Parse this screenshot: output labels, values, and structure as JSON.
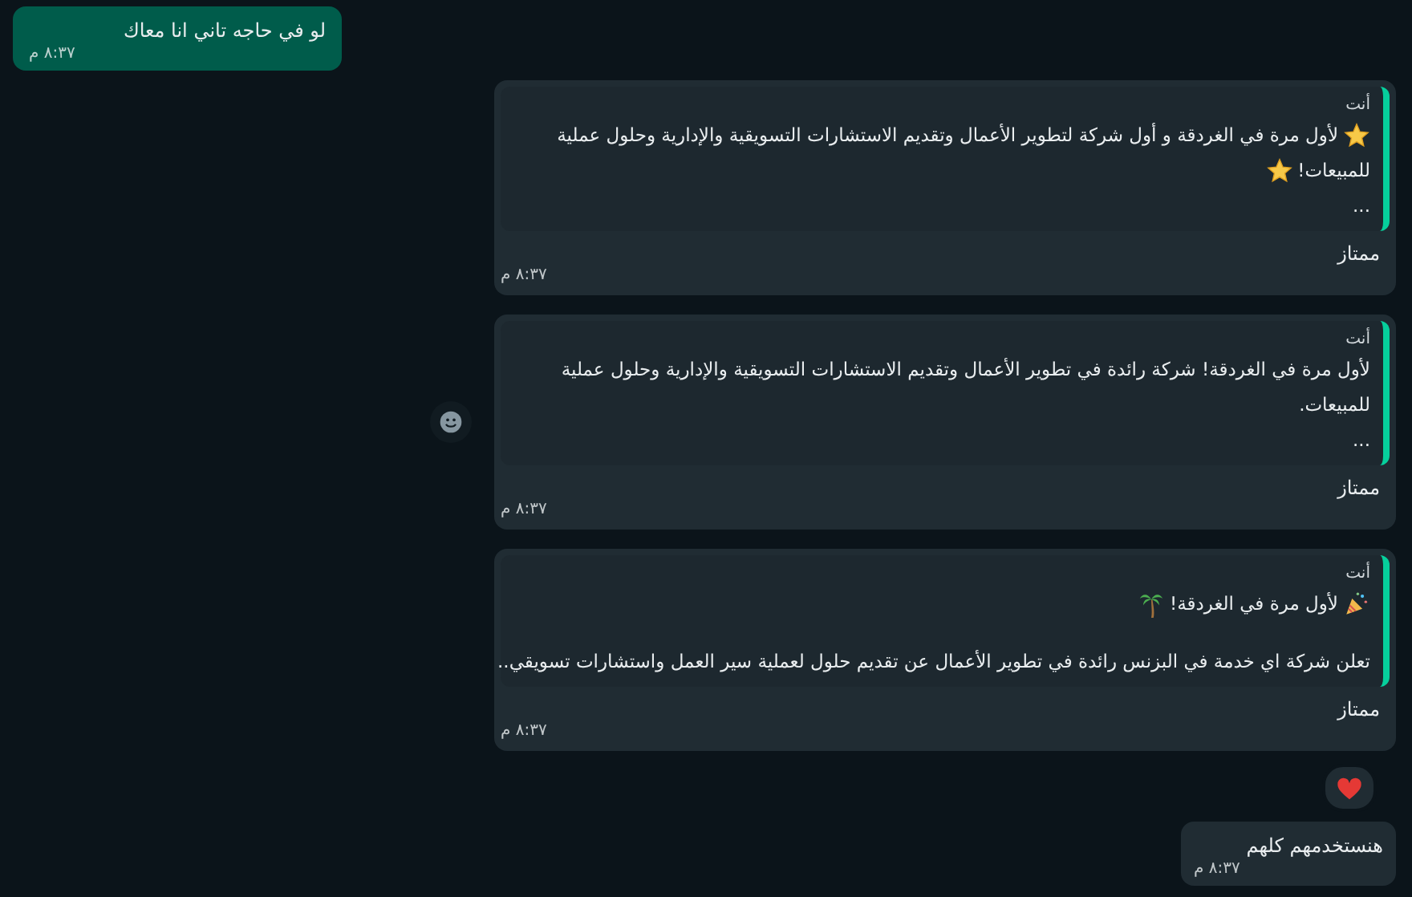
{
  "messages": [
    {
      "kind": "note",
      "text": "لو في حاجه تاني انا معاك",
      "time": "٨:٣٧ م"
    },
    {
      "kind": "reply",
      "quote": {
        "sender": "أنت",
        "paragraphs": [
          [
            {
              "kind": "star"
            },
            {
              "kind": "text",
              "text": "لأول مرة في الغردقة و أول شركة لتطوير الأعمال وتقديم الاستشارات التسويقية والإدارية وحلول عملية"
            }
          ],
          [
            {
              "kind": "text",
              "text": "للمبيعات!"
            },
            {
              "kind": "star"
            }
          ],
          [
            {
              "kind": "text",
              "text": "..."
            }
          ]
        ]
      },
      "text": "ممتاز",
      "time": "٨:٣٧ م",
      "react_button": false,
      "reacted": false
    },
    {
      "kind": "reply",
      "quote": {
        "sender": "أنت",
        "paragraphs": [
          [
            {
              "kind": "text",
              "text": "لأول مرة في الغردقة! شركة رائدة في تطوير الأعمال وتقديم الاستشارات التسويقية والإدارية وحلول عملية"
            }
          ],
          [
            {
              "kind": "text",
              "text": "للمبيعات."
            }
          ],
          [
            {
              "kind": "text",
              "text": "..."
            }
          ]
        ]
      },
      "text": "ممتاز",
      "time": "٨:٣٧ م",
      "react_button": true,
      "reacted": false
    },
    {
      "kind": "reply",
      "quote": {
        "sender": "أنت",
        "paragraphs": [
          [
            {
              "kind": "party"
            },
            {
              "kind": "text",
              "text": "لأول مرة في الغردقة!"
            },
            {
              "kind": "palm"
            }
          ],
          [
            {
              "kind": "gap"
            }
          ],
          [
            {
              "kind": "text",
              "text": "تعلن شركة اي خدمة في البزنس رائدة في تطوير الأعمال عن تقديم حلول لعملية سير العمل واستشارات تسويقي.."
            }
          ]
        ]
      },
      "text": "ممتاز",
      "time": "٨:٣٧ م",
      "react_button": false,
      "reacted": true
    },
    {
      "kind": "plain",
      "text": "هنستخدمهم كلهم",
      "time": "٨:٣٧ م"
    }
  ]
}
